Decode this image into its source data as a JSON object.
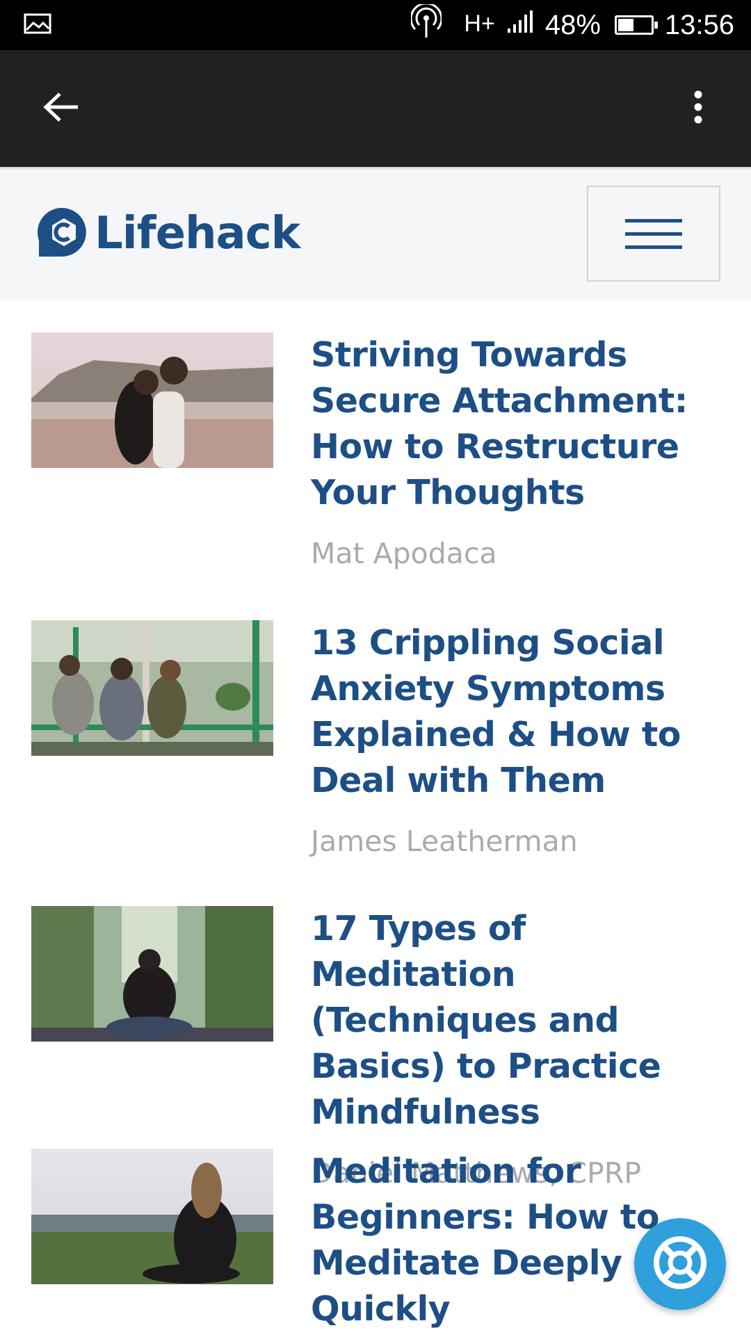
{
  "status_bar": {
    "battery_percent": "48%",
    "battery_level": 0.48,
    "time": "13:56",
    "network": "H+",
    "icons": [
      "image-icon",
      "hotspot-icon",
      "network-h-plus-icon",
      "signal-icon",
      "battery-icon"
    ]
  },
  "app_bar": {
    "back_icon": "arrow-left-icon",
    "overflow_icon": "more-vert-icon"
  },
  "header": {
    "logo_text": "Lifehack",
    "menu_icon": "hamburger-icon",
    "brand_color": "#1d4f86"
  },
  "articles": [
    {
      "title": "Striving Towards Secure Attachment: How to Restructure Your Thoughts",
      "author": "Mat Apodaca",
      "thumbnail": "couple-on-beach-photo"
    },
    {
      "title": "13 Crippling Social Anxiety Symptoms Explained & How to Deal with Them",
      "author": "James Leatherman",
      "thumbnail": "friends-on-porch-photo"
    },
    {
      "title": "17 Types of Meditation (Techniques and Basics) to Practice Mindfulness",
      "author": "Daniel Matthews, CPRP",
      "thumbnail": "woman-meditating-in-forest-photo"
    },
    {
      "title": "Meditation for Beginners: How to Meditate Deeply and Quickly",
      "author": "",
      "thumbnail": "woman-sitting-in-field-photo"
    }
  ],
  "fab": {
    "icon": "lifebuoy-icon",
    "color": "#2fa0dc"
  }
}
